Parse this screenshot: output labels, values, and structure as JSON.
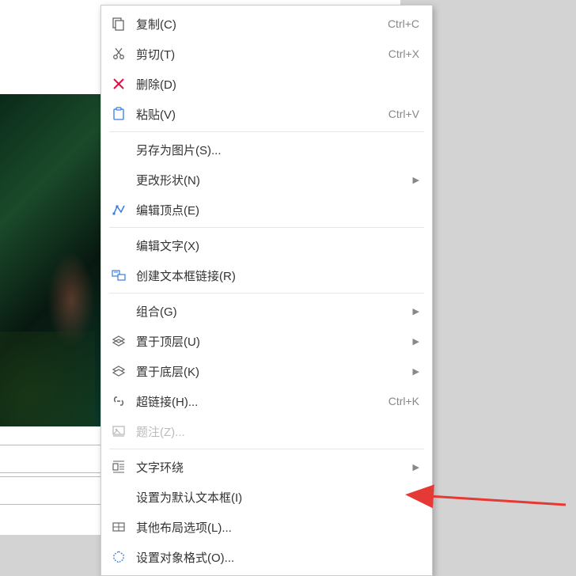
{
  "menu": {
    "items": [
      {
        "icon": "copy-icon",
        "label": "复制(C)",
        "shortcut": "Ctrl+C"
      },
      {
        "icon": "cut-icon",
        "label": "剪切(T)",
        "shortcut": "Ctrl+X"
      },
      {
        "icon": "delete-icon",
        "label": "删除(D)",
        "shortcut": ""
      },
      {
        "icon": "paste-icon",
        "label": "粘贴(V)",
        "shortcut": "Ctrl+V"
      },
      {
        "sep": true
      },
      {
        "icon": "",
        "label": "另存为图片(S)...",
        "shortcut": ""
      },
      {
        "icon": "",
        "label": "更改形状(N)",
        "shortcut": "",
        "submenu": true
      },
      {
        "icon": "edit-points-icon",
        "label": "编辑顶点(E)",
        "shortcut": ""
      },
      {
        "sep": true
      },
      {
        "icon": "",
        "label": "编辑文字(X)",
        "shortcut": ""
      },
      {
        "icon": "textbox-link-icon",
        "label": "创建文本框链接(R)",
        "shortcut": ""
      },
      {
        "sep": true
      },
      {
        "icon": "",
        "label": "组合(G)",
        "shortcut": "",
        "submenu": true
      },
      {
        "icon": "bring-front-icon",
        "label": "置于顶层(U)",
        "shortcut": "",
        "submenu": true
      },
      {
        "icon": "send-back-icon",
        "label": "置于底层(K)",
        "shortcut": "",
        "submenu": true
      },
      {
        "icon": "hyperlink-icon",
        "label": "超链接(H)...",
        "shortcut": "Ctrl+K"
      },
      {
        "icon": "caption-icon",
        "label": "题注(Z)...",
        "shortcut": "",
        "disabled": true
      },
      {
        "sep": true
      },
      {
        "icon": "text-wrap-icon",
        "label": "文字环绕",
        "shortcut": "",
        "submenu": true
      },
      {
        "icon": "",
        "label": "设置为默认文本框(I)",
        "shortcut": ""
      },
      {
        "icon": "layout-icon",
        "label": "其他布局选项(L)...",
        "shortcut": ""
      },
      {
        "icon": "format-object-icon",
        "label": "设置对象格式(O)...",
        "shortcut": ""
      }
    ]
  }
}
